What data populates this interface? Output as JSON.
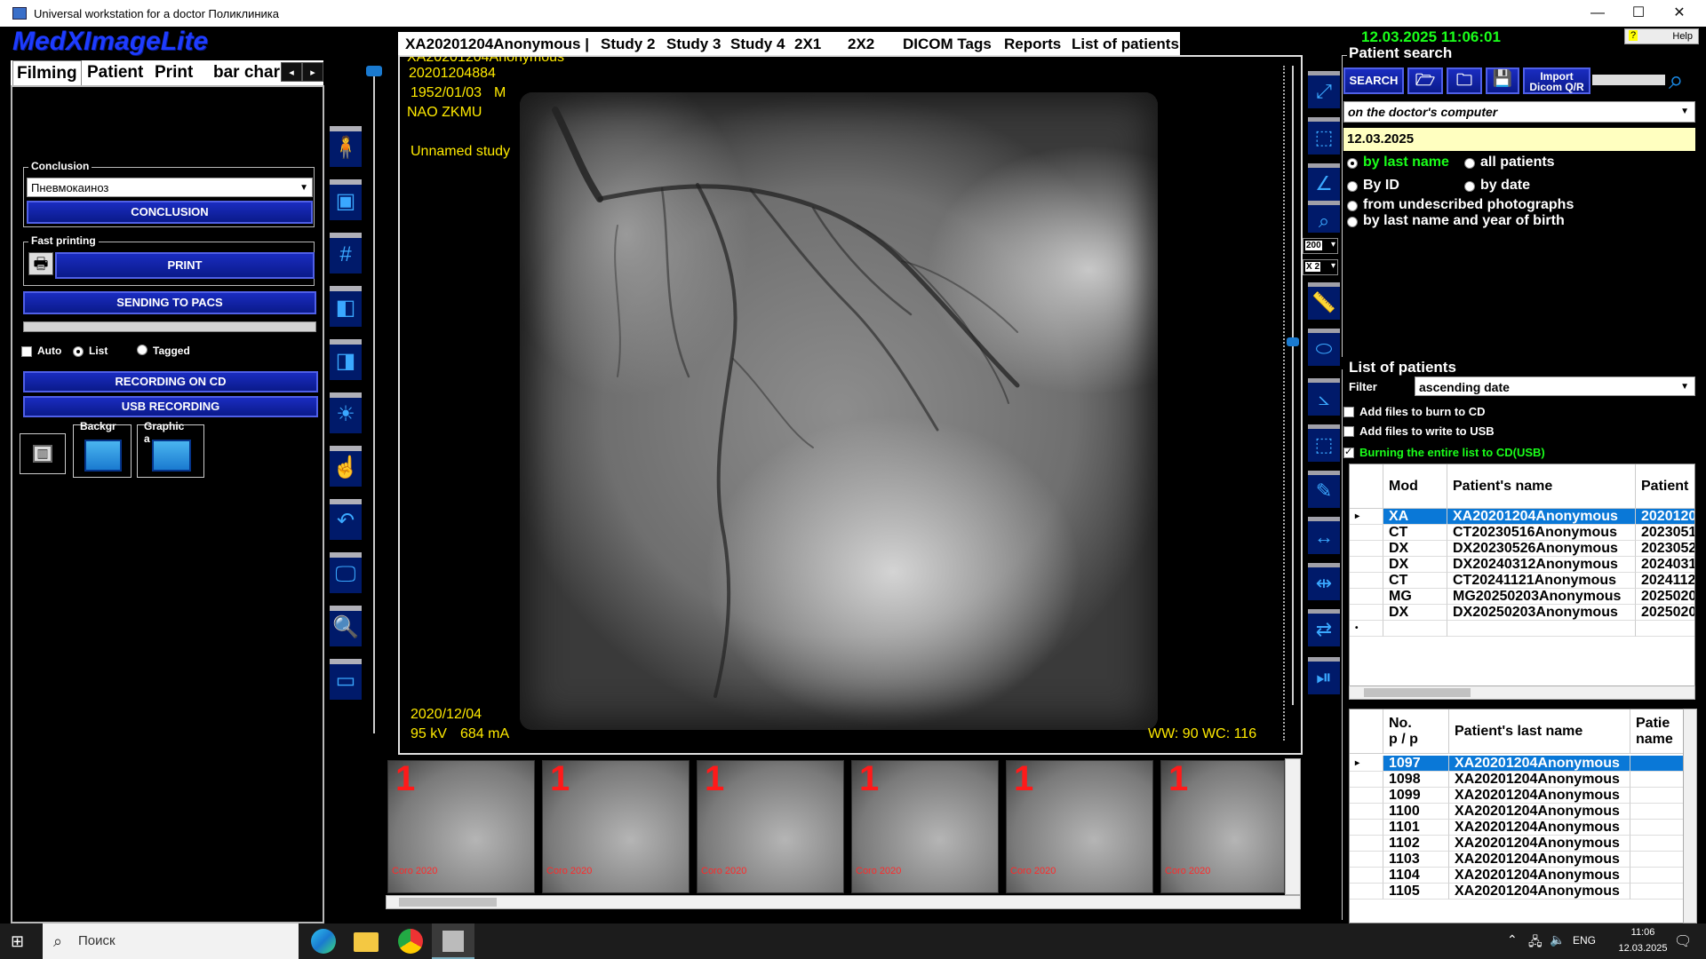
{
  "window": {
    "title": "Universal workstation for a doctor  Поликлиника",
    "minimize": "—",
    "maximize": "☐",
    "close": "✕"
  },
  "brand": "MedXImageLite",
  "left_tabs": [
    "Filming",
    "Patient",
    "Print",
    "bar char"
  ],
  "left_panel": {
    "conclusion_group": "Conclusion",
    "conclusion_value": "Пневмокаиноз",
    "conclusion_button": "CONCLUSION",
    "fast_printing_group": "Fast printing",
    "print_button": "PRINT",
    "pacs_button": "SENDING TO PACS",
    "auto_label": "Auto",
    "list_label": "List",
    "tagged_label": "Tagged",
    "cd_button": "RECORDING ON CD",
    "usb_button": "USB RECORDING",
    "backgr_label": "Backgr",
    "graphic_label": "Graphic",
    "graphic_sub": "a"
  },
  "study_tabs": [
    "XA20201204Anonymous |",
    "Study 2",
    "Study 3",
    "Study 4",
    "2X1",
    "2X2",
    "DICOM Tags",
    "Reports",
    "List of patients"
  ],
  "overlay": {
    "patient": "XA20201204Anonymous",
    "id": "20201204884",
    "birth": "1952/01/03",
    "sex": "M",
    "institution": "NAO ZKMU",
    "study": "Unnamed study",
    "date": "2020/12/04",
    "kv": "95 kV",
    "ma": "684  mA",
    "wwwc": "WW: 90  WC: 116"
  },
  "thumbnails": [
    {
      "num": "1",
      "caption": "Coro 2020"
    },
    {
      "num": "1",
      "caption": "Coro 2020"
    },
    {
      "num": "1",
      "caption": "Coro 2020"
    },
    {
      "num": "1",
      "caption": "Coro 2020"
    },
    {
      "num": "1",
      "caption": "Coro 2020"
    },
    {
      "num": "1",
      "caption": "Coro 2020"
    }
  ],
  "zoom_values": {
    "zoom": "200",
    "factor": "X 2"
  },
  "right_panel": {
    "clock": "12.03.2025 11:06:01",
    "help": "Help",
    "search_title": "Patient search",
    "search_button": "SEARCH",
    "import_button_line1": "Import",
    "import_button_line2": "Dicom Q/R",
    "source_value": "on the doctor's computer",
    "date_value": "12.03.2025",
    "by_last_name": "by last name",
    "all_patients": "all patients",
    "by_id": "By ID",
    "by_date": "by date",
    "from_undescribed": "from undescribed photographs",
    "by_last_name_year": "by last name and year of birth",
    "list_title": "List of patients",
    "filter_label": "Filter",
    "filter_value": "ascending date",
    "add_cd": "Add files to burn to CD",
    "add_usb": "Add files to write to USB",
    "burn_all": "Burning the entire list to CD(USB)"
  },
  "patients_table": {
    "columns": [
      "Mod",
      "Patient's name",
      "Patient"
    ],
    "rows": [
      {
        "mod": "XA",
        "name": "XA20201204Anonymous",
        "id": "2020120"
      },
      {
        "mod": "CT",
        "name": "CT20230516Anonymous",
        "id": "2023051"
      },
      {
        "mod": "DX",
        "name": "DX20230526Anonymous",
        "id": "2023052"
      },
      {
        "mod": "DX",
        "name": "DX20240312Anonymous",
        "id": "2024031"
      },
      {
        "mod": "CT",
        "name": "CT20241121Anonymous",
        "id": "2024112"
      },
      {
        "mod": "MG",
        "name": "MG20250203Anonymous",
        "id": "2025020"
      },
      {
        "mod": "DX",
        "name": "DX20250203Anonymous",
        "id": "2025020"
      }
    ]
  },
  "images_table": {
    "col_no_line1": "No.",
    "col_no_line2": "p / p",
    "col_last": "Patient's last name",
    "col_name_line1": "Patie",
    "col_name_line2": "name",
    "rows": [
      {
        "no": "1097",
        "name": "XA20201204Anonymous"
      },
      {
        "no": "1098",
        "name": "XA20201204Anonymous"
      },
      {
        "no": "1099",
        "name": "XA20201204Anonymous"
      },
      {
        "no": "1100",
        "name": "XA20201204Anonymous"
      },
      {
        "no": "1101",
        "name": "XA20201204Anonymous"
      },
      {
        "no": "1102",
        "name": "XA20201204Anonymous"
      },
      {
        "no": "1103",
        "name": "XA20201204Anonymous"
      },
      {
        "no": "1104",
        "name": "XA20201204Anonymous"
      },
      {
        "no": "1105",
        "name": "XA20201204Anonymous"
      }
    ]
  },
  "taskbar": {
    "search": "Поиск",
    "lang": "ENG",
    "time": "11:06",
    "date": "12.03.2025"
  }
}
